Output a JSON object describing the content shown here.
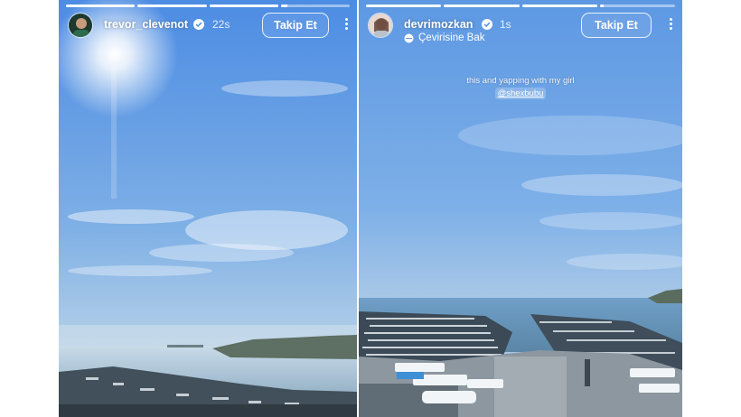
{
  "stories": [
    {
      "username": "trevor_clevenot",
      "verified": true,
      "time": "22s",
      "follow_label": "Takip Et",
      "progress": [
        1.0,
        1.0,
        1.0,
        0.1
      ]
    },
    {
      "username": "devrimozkan",
      "verified": true,
      "time": "1s",
      "translation_label": "Çevirisine Bak",
      "follow_label": "Takip Et",
      "caption": "this and yapping with my girl",
      "mention": "@shexbubu",
      "progress": [
        1.0,
        1.0,
        1.0,
        0.05
      ]
    }
  ],
  "colors": {
    "sky_top": "#4f8de0",
    "sky_bottom": "#a7c6e6",
    "sea": "#7aa9c8",
    "text": "#ffffff"
  },
  "icons": [
    "verified-badge-icon",
    "more-options-icon",
    "translate-icon"
  ]
}
